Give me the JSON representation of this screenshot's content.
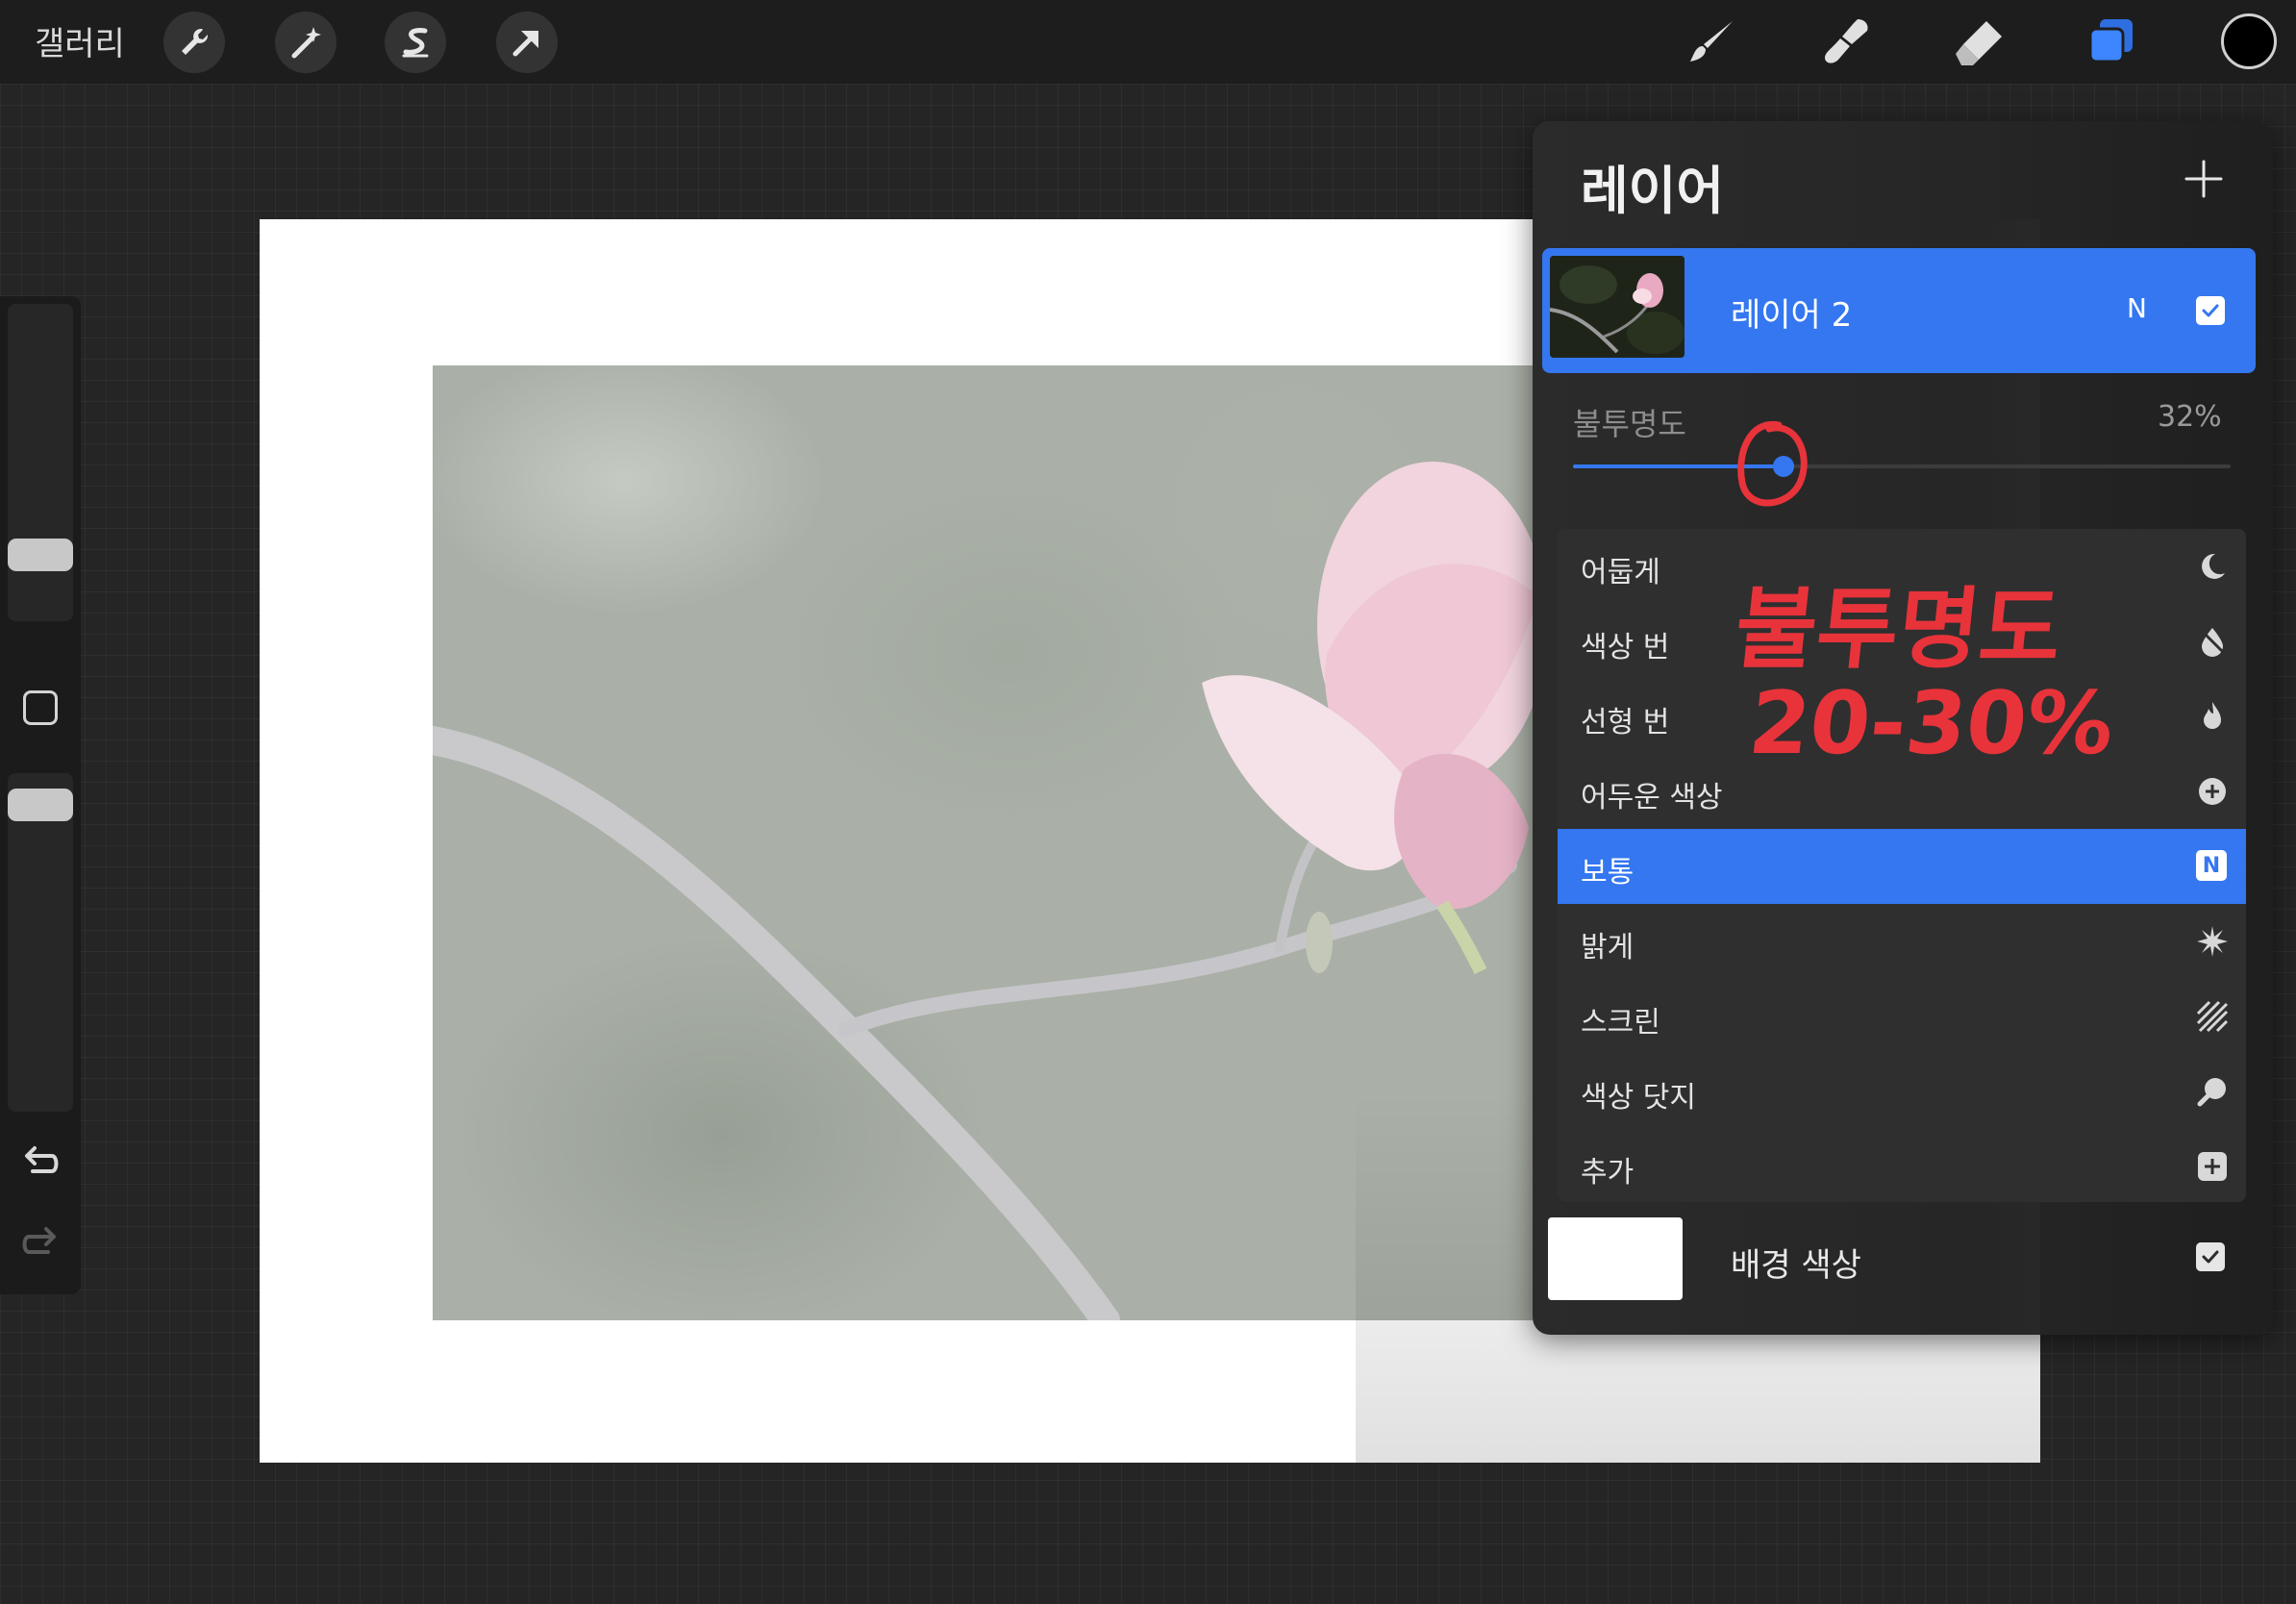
{
  "topbar": {
    "gallery_label": "갤러리",
    "left_tools": [
      "wrench-icon",
      "magic-wand-icon",
      "selection-s-icon",
      "transform-arrow-icon"
    ],
    "right_tools": [
      "brush-icon",
      "smudge-icon",
      "eraser-icon",
      "layers-icon"
    ],
    "current_color": "#000000"
  },
  "layers_panel": {
    "title": "레이어",
    "active_layer": {
      "name": "레이어 2",
      "blend_mode_short": "N",
      "visible": true
    },
    "opacity": {
      "label": "불투명도",
      "value_text": "32%",
      "value": 32
    },
    "blend_modes": [
      {
        "label": "어둡게",
        "icon": "moon-icon",
        "selected": false
      },
      {
        "label": "색상 번",
        "icon": "burn-drop-icon",
        "selected": false
      },
      {
        "label": "선형 번",
        "icon": "flame-icon",
        "selected": false
      },
      {
        "label": "어두운 색상",
        "icon": "plus-circle-icon",
        "selected": false
      },
      {
        "label": "보통",
        "icon": "n-badge-icon",
        "selected": true,
        "badge": "N"
      },
      {
        "label": "밝게",
        "icon": "sun-burst-icon",
        "selected": false
      },
      {
        "label": "스크린",
        "icon": "hatch-icon",
        "selected": false
      },
      {
        "label": "색상 닷지",
        "icon": "dodge-icon",
        "selected": false
      },
      {
        "label": "추가",
        "icon": "plus-square-icon",
        "selected": false
      }
    ],
    "background_layer": {
      "name": "배경 색상",
      "color": "#ffffff",
      "visible": true
    }
  },
  "annotation": {
    "line1": "불투명도",
    "line2": "20-30%",
    "color": "#e8333b"
  },
  "accent_color": "#3477f0"
}
